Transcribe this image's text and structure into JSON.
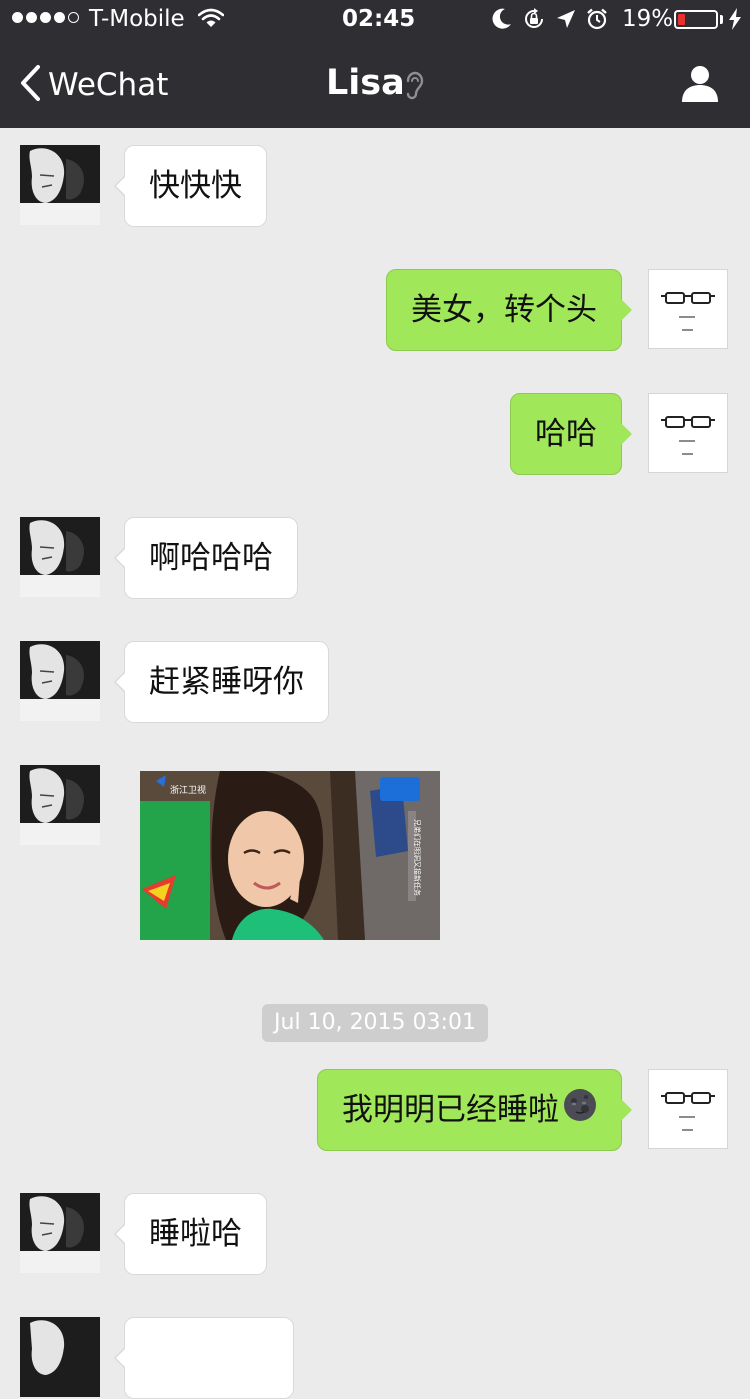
{
  "status_bar": {
    "carrier": "T-Mobile",
    "time": "02:45",
    "battery_percent": "19%",
    "signal_bars_filled": 4,
    "signal_bars_total": 5,
    "battery_level": 0.19,
    "icons": [
      "moon-icon",
      "rotation-lock-icon",
      "location-arrow-icon",
      "alarm-icon",
      "charging-bolt-icon"
    ]
  },
  "nav": {
    "back_label": "WeChat",
    "title": "Lisa",
    "title_icon": "ear-icon",
    "right_icon": "profile-icon"
  },
  "messages": [
    {
      "side": "left",
      "text": "快快快"
    },
    {
      "side": "right",
      "text": "美女，转个头"
    },
    {
      "side": "right",
      "text": "哈哈"
    },
    {
      "side": "left",
      "text": "啊哈哈哈"
    },
    {
      "side": "left",
      "text": "赶紧睡呀你"
    },
    {
      "side": "left",
      "type": "image",
      "image_overlay_texts": [
        "浙江卫视",
        "兄弟们在明洞又接新任务"
      ]
    },
    {
      "side": "right",
      "text": "我明明已经睡啦",
      "emoji": "new-moon-face-emoji"
    },
    {
      "side": "left",
      "text": "睡啦哈"
    }
  ],
  "timestamp": "Jul 10, 2015 03:01",
  "colors": {
    "header_bg": "#2f2f33",
    "chat_bg": "#ebebeb",
    "sent_bubble": "#a0e75a",
    "received_bubble": "#ffffff",
    "timestamp_bg": "#cecece",
    "battery_low": "#e8302e"
  }
}
